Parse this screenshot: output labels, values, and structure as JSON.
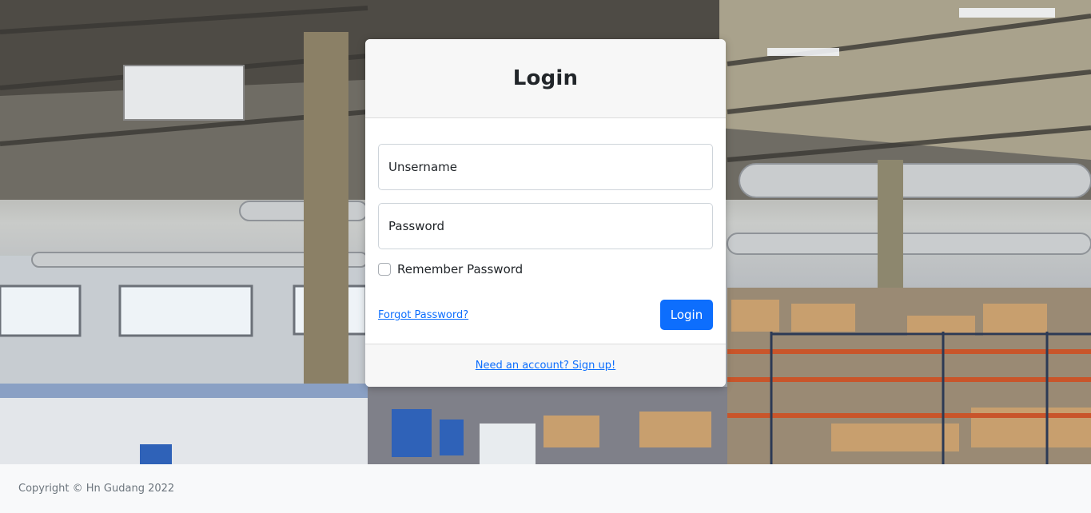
{
  "card": {
    "title": "Login",
    "username_placeholder": "Unsername",
    "password_placeholder": "Password",
    "remember_label": "Remember Password",
    "forgot_label": "Forgot Password?",
    "login_button": "Login",
    "signup_label": "Need an account? Sign up!"
  },
  "footer": {
    "copyright": "Copyright © Hn Gudang 2022"
  },
  "colors": {
    "primary": "#0d6efd",
    "footer_bg": "#f8f9fa"
  }
}
